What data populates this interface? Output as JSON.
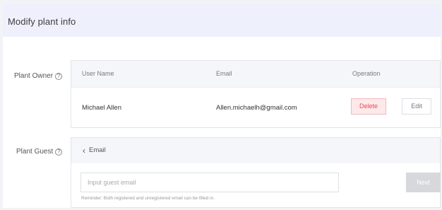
{
  "header": {
    "title": "Modify plant info"
  },
  "owner": {
    "label": "Plant Owner",
    "help": "?",
    "columns": [
      "User Name",
      "Email",
      "Operation"
    ],
    "row": {
      "user_name": "Michael Allen",
      "email": "Allen.michaelh@gmail.com",
      "delete_label": "Delete",
      "edit_label": "Edit"
    }
  },
  "guest": {
    "label": "Plant Guest",
    "help": "?",
    "back_icon": "‹",
    "back_label": "Email",
    "input_placeholder": "Input guest email",
    "next_label": "Next",
    "reminder": "Reminder: Both registered and unregistered email can be filled in."
  },
  "colors": {
    "header_bg": "#eef1fb",
    "delete_text": "#e24c57",
    "delete_bg": "#fde9ea",
    "next_bg": "#d6d8dc"
  }
}
